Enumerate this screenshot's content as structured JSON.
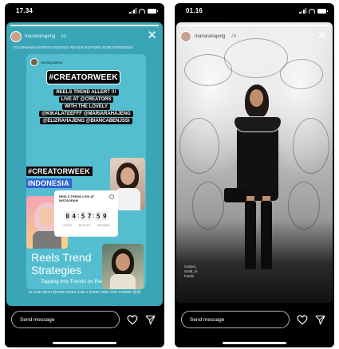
{
  "left_phone": {
    "time": "17.34",
    "story": {
      "username": "mariarahajeng",
      "posted": "8h",
      "caption_line": "YOLO#WANNA BE#WITH BESTIES #DIANACREATORS #CREATORSWEEK",
      "progress_fraction": 1.0
    },
    "repost": {
      "username": "reelsbyadena",
      "tag": "#CREATORWEEK",
      "caption_lines": [
        "REELS TREND ALLERT !!!",
        "LIVE AT @CREATORS",
        "WITH THE LOVELY",
        "@KIKALATEEFFF @MARIARAHAJENG",
        "@ELIZRAHAJENG @BIANCABENJSSI"
      ],
      "banner_tag": "#CREATORWEEK",
      "banner_sub": "INDONESIA",
      "countdown": {
        "title": "REELS TREND LIVE AT INSTAGRAM",
        "digits": [
          "0",
          "4",
          "5",
          "7",
          "5",
          "9"
        ],
        "units": [
          "HOURS",
          "MINUTES",
          "SECONDS"
        ]
      },
      "title": "Reels Trend Strategies",
      "subtitle": "Tapping into Trends on Reels"
    },
    "footer_text": "IG LIVE WITH @CREATORS JAM 4 SORE! SEE YOU THERE! 😊😊",
    "composer": {
      "placeholder": "Send message"
    }
  },
  "right_phone": {
    "time": "01.16",
    "story": {
      "username": "mariarahajeng",
      "posted": "7h",
      "watermark": "Cassel_\nSotld_m\nFaeke",
      "progress_fraction": 1.0
    },
    "composer": {
      "placeholder": "Send message"
    }
  },
  "icons": {
    "heart": "heart-icon",
    "send": "send-icon",
    "close": "close-icon"
  },
  "colors": {
    "left_story_bg": "#3aa5b6",
    "banner_blue": "#2e62cf"
  }
}
